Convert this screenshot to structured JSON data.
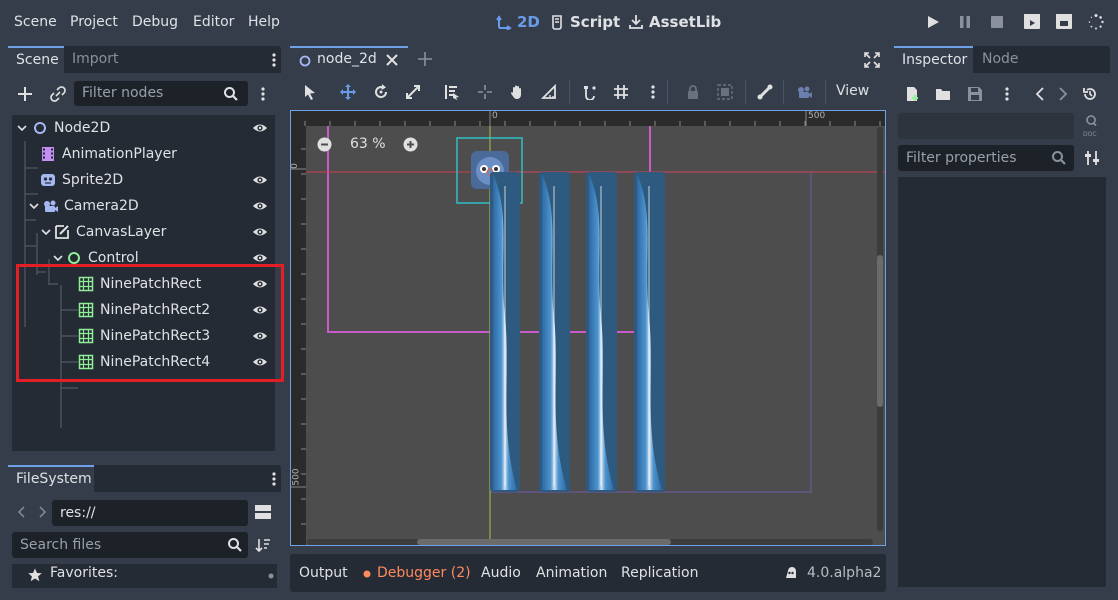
{
  "menu": {
    "items": [
      "Scene",
      "Project",
      "Debug",
      "Editor",
      "Help"
    ],
    "modes": [
      {
        "label": "2D",
        "icon": "2d-icon",
        "active": true
      },
      {
        "label": "Script",
        "icon": "script-icon",
        "active": false
      },
      {
        "label": "AssetLib",
        "icon": "assetlib-icon",
        "active": false
      }
    ]
  },
  "scene_dock": {
    "tabs": [
      "Scene",
      "Import"
    ],
    "filter_placeholder": "Filter nodes",
    "nodes": [
      {
        "label": "Node2D",
        "icon": "node2d-icon",
        "color": "#a5b7f3"
      },
      {
        "label": "AnimationPlayer",
        "icon": "animation-player-icon",
        "color": "#c38ef1"
      },
      {
        "label": "Sprite2D",
        "icon": "sprite2d-icon",
        "color": "#a5b7f3"
      },
      {
        "label": "Camera2D",
        "icon": "camera2d-icon",
        "color": "#a5b7f3"
      },
      {
        "label": "CanvasLayer",
        "icon": "canvas-layer-icon",
        "color": "#e0e0e0"
      },
      {
        "label": "Control",
        "icon": "control-icon",
        "color": "#8eef97"
      },
      {
        "label": "NinePatchRect",
        "icon": "ninepatch-icon",
        "color": "#8eef97"
      },
      {
        "label": "NinePatchRect2",
        "icon": "ninepatch-icon",
        "color": "#8eef97"
      },
      {
        "label": "NinePatchRect3",
        "icon": "ninepatch-icon",
        "color": "#8eef97"
      },
      {
        "label": "NinePatchRect4",
        "icon": "ninepatch-icon",
        "color": "#8eef97"
      }
    ]
  },
  "filesystem": {
    "tab": "FileSystem",
    "path": "res://",
    "search_placeholder": "Search files",
    "favorites": "Favorites:"
  },
  "editor": {
    "tab_label": "node_2d",
    "zoom": "63 %",
    "view_label": "View",
    "ruler_top": [
      "0",
      "500"
    ],
    "ruler_left": [
      "0",
      "500"
    ]
  },
  "bottom_bar": {
    "tabs": [
      "Output",
      "Debugger (2)",
      "Audio",
      "Animation",
      "Replication"
    ],
    "version": "4.0.alpha2",
    "debugger_color": "#ff8a5e"
  },
  "inspector": {
    "tabs": [
      "Inspector",
      "Node"
    ],
    "filter_placeholder": "Filter properties"
  },
  "colors": {
    "accent": "#699ce8",
    "highlight_box": "#e31e24"
  }
}
